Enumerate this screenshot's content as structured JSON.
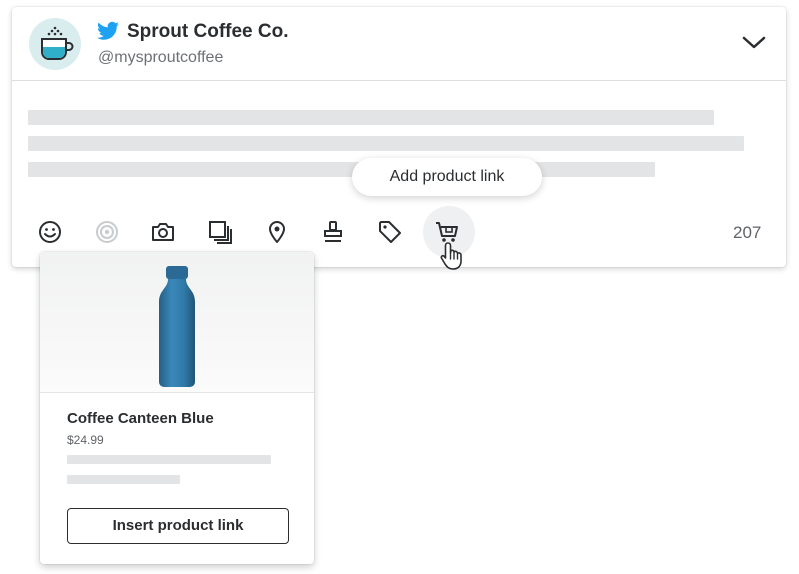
{
  "account": {
    "name": "Sprout Coffee Co.",
    "handle": "@mysproutcoffee",
    "network_icon": "twitter-bird-icon",
    "brand_color": "#1da1f2"
  },
  "header": {
    "expand_icon": "chevron-down-icon"
  },
  "tooltip": {
    "label": "Add product link"
  },
  "toolbar": {
    "icons": [
      "emoji-icon",
      "target-icon",
      "camera-icon",
      "gallery-icon",
      "location-pin-icon",
      "stamp-icon",
      "tag-icon",
      "shopping-cart-icon"
    ],
    "character_count": "207"
  },
  "product_card": {
    "name": "Coffee Canteen Blue",
    "price": "$24.99",
    "button_label": "Insert product link",
    "bottle_color": "#2f79a8"
  }
}
